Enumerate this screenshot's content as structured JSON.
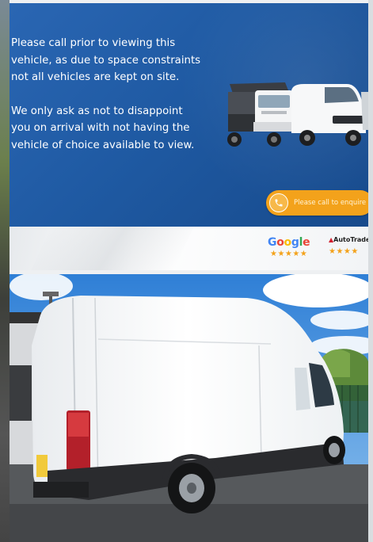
{
  "banner": {
    "notice_line_1": "Please call prior to viewing this vehicle, as due to space constraints not all vehicles are kept on site.",
    "notice_line_2": "We only ask as not to disappoint you on arrival with not having the vehicle of choice available to view.",
    "cta_label": "Please call to enquire",
    "cta_icon": "phone-icon"
  },
  "reviews": {
    "google_logo": "Google",
    "google_stars": "★★★★★",
    "autotrader_logo": "AutoTrader",
    "autotrader_stars": "★★★★"
  },
  "photo": {
    "subject": "van-photo"
  },
  "colors": {
    "banner_blue": "#1f5aa3",
    "cta_orange": "#f3a21b",
    "star_orange": "#f3a21b"
  }
}
